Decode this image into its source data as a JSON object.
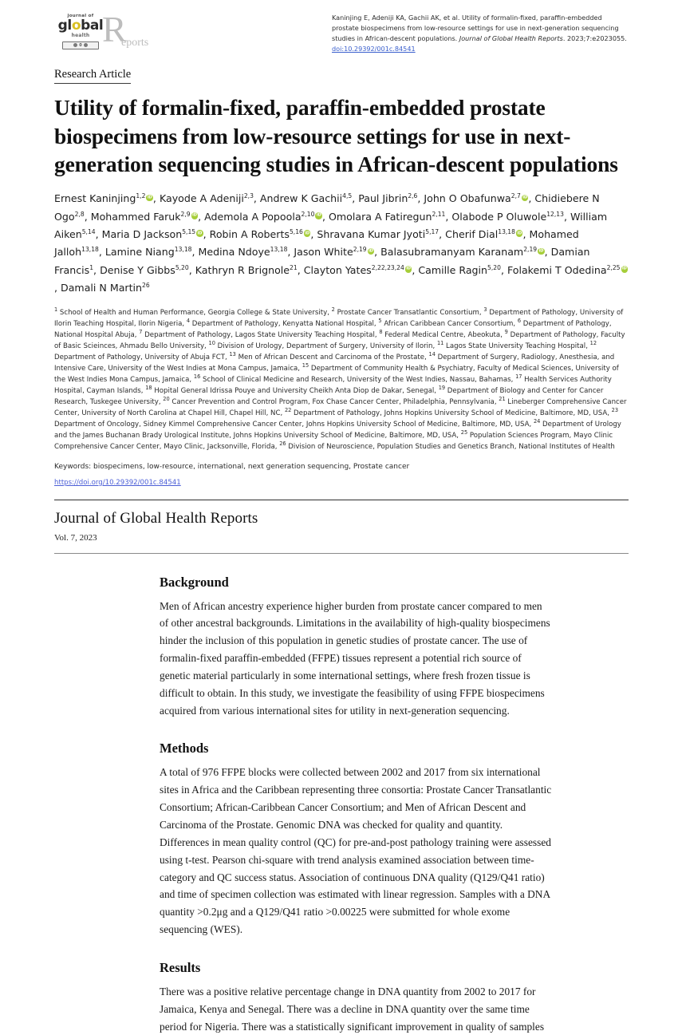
{
  "logo": {
    "journal_of": "journal of",
    "global": "global",
    "global_o": "o",
    "global_pre": "gl",
    "global_post": "bal",
    "health": "health",
    "bar_label": "0",
    "r": "R",
    "eports": "eports"
  },
  "citation": {
    "text_1": "Kaninjing E, Adeniji KA, Gachii AK, et al. Utility of formalin-fixed, paraffin-embedded prostate biospecimens from low-resource settings for use in next-generation sequencing studies in African-descent populations. ",
    "journal_italic": "Journal of Global Health Reports",
    "text_2": ". 2023;7:e2023055. ",
    "doi_label": "doi:10.29392/001c.84541"
  },
  "article": {
    "kicker": "Research Article",
    "title": "Utility of formalin-fixed, paraffin-embedded prostate biospecimens from low-resource settings for use in next-generation sequencing studies in African-descent populations",
    "keywords": "Keywords: biospecimens, low-resource, international, next generation sequencing, Prostate cancer",
    "doi_url": "https://doi.org/10.29392/001c.84541"
  },
  "authors": [
    {
      "name": "Ernest Kaninjing",
      "sup": "1,2",
      "orcid": true,
      "sep": ", "
    },
    {
      "name": "Kayode A Adeniji",
      "sup": "2,3",
      "orcid": false,
      "sep": ", "
    },
    {
      "name": "Andrew K Gachii",
      "sup": "4,5",
      "orcid": false,
      "sep": ", "
    },
    {
      "name": "Paul Jibrin",
      "sup": "2,6",
      "orcid": false,
      "sep": ", "
    },
    {
      "name": "John O Obafunwa",
      "sup": "2,7",
      "orcid": true,
      "sep": ", "
    },
    {
      "name": "Chidiebere N Ogo",
      "sup": "2,8",
      "orcid": false,
      "sep": ", "
    },
    {
      "name": "Mohammed Faruk",
      "sup": "2,9",
      "orcid": true,
      "sep": ", "
    },
    {
      "name": "Ademola A Popoola",
      "sup": "2,10",
      "orcid": true,
      "sep": ", "
    },
    {
      "name": "Omolara A Fatiregun",
      "sup": "2,11",
      "orcid": false,
      "sep": ", "
    },
    {
      "name": "Olabode P Oluwole",
      "sup": "12,13",
      "orcid": false,
      "sep": ", "
    },
    {
      "name": "William Aiken",
      "sup": "5,14",
      "orcid": false,
      "sep": ", "
    },
    {
      "name": "Maria D Jackson",
      "sup": "5,15",
      "orcid": true,
      "sep": ", "
    },
    {
      "name": "Robin A Roberts",
      "sup": "5,16",
      "orcid": true,
      "sep": ", "
    },
    {
      "name": "Shravana Kumar Jyoti",
      "sup": "5,17",
      "orcid": false,
      "sep": ", "
    },
    {
      "name": "Cherif Dial",
      "sup": "13,18",
      "orcid": true,
      "sep": ", "
    },
    {
      "name": "Mohamed Jalloh",
      "sup": "13,18",
      "orcid": false,
      "sep": ", "
    },
    {
      "name": "Lamine Niang",
      "sup": "13,18",
      "orcid": false,
      "sep": ", "
    },
    {
      "name": "Medina Ndoye",
      "sup": "13,18",
      "orcid": false,
      "sep": ", "
    },
    {
      "name": "Jason White",
      "sup": "2,19",
      "orcid": true,
      "sep": ", "
    },
    {
      "name": "Balasubramanyam Karanam",
      "sup": "2,19",
      "orcid": true,
      "sep": ", "
    },
    {
      "name": "Damian Francis",
      "sup": "1",
      "orcid": false,
      "sep": ", "
    },
    {
      "name": "Denise Y Gibbs",
      "sup": "5,20",
      "orcid": false,
      "sep": ", "
    },
    {
      "name": "Kathryn R Brignole",
      "sup": "21",
      "orcid": false,
      "sep": ", "
    },
    {
      "name": "Clayton Yates",
      "sup": "2,22,23,24",
      "orcid": true,
      "sep": ", "
    },
    {
      "name": "Camille Ragin",
      "sup": "5,20",
      "orcid": false,
      "sep": ", "
    },
    {
      "name": "Folakemi T Odedina",
      "sup": "2,25",
      "orcid": true,
      "sep": ", "
    },
    {
      "name": "Damali N Martin",
      "sup": "26",
      "orcid": false,
      "sep": ""
    }
  ],
  "affiliations": [
    {
      "num": "1",
      "text": " School of Health and Human Performance, Georgia College & State University, "
    },
    {
      "num": "2",
      "text": " Prostate Cancer Transatlantic Consortium, "
    },
    {
      "num": "3",
      "text": " Department of Pathology, University of Ilorin Teaching Hospital, Ilorin Nigeria, "
    },
    {
      "num": "4",
      "text": " Department of Pathology, Kenyatta National Hospital, "
    },
    {
      "num": "5",
      "text": " African Caribbean Cancer Consortium, "
    },
    {
      "num": "6",
      "text": " Department of Pathology, National Hospital Abuja, "
    },
    {
      "num": "7",
      "text": " Department of Pathology, Lagos State University Teaching Hospital, "
    },
    {
      "num": "8",
      "text": " Federal Medical Centre, Abeokuta, "
    },
    {
      "num": "9",
      "text": " Department of Pathology, Faculty of Basic Scieinces, Ahmadu Bello University, "
    },
    {
      "num": "10",
      "text": " Division of Urology, Department of Surgery, University of Ilorin, "
    },
    {
      "num": "11",
      "text": " Lagos State University Teaching Hospital, "
    },
    {
      "num": "12",
      "text": " Department of Pathology, University of Abuja FCT, "
    },
    {
      "num": "13",
      "text": " Men of African Descent and Carcinoma of the Prostate, "
    },
    {
      "num": "14",
      "text": " Department of Surgery, Radiology, Anesthesia, and Intensive Care, University of the West Indies at Mona Campus, Jamaica, "
    },
    {
      "num": "15",
      "text": " Department of Community Health & Psychiatry, Faculty of Medical Sciences, University of the West Indies Mona Campus, Jamaica, "
    },
    {
      "num": "16",
      "text": " School of Clinical Medicine and Research, University of the West Indies, Nassau, Bahamas, "
    },
    {
      "num": "17",
      "text": " Health Services Authority Hospital, Cayman Islands, "
    },
    {
      "num": "18",
      "text": " Hopital General Idrissa Pouye and University Cheikh Anta Diop de Dakar, Senegal, "
    },
    {
      "num": "19",
      "text": " Department of Biology and Center for Cancer Research, Tuskegee University, "
    },
    {
      "num": "20",
      "text": " Cancer Prevention and Control Program, Fox Chase Cancer Center, Philadelphia, Pennsylvania, "
    },
    {
      "num": "21",
      "text": " Lineberger Comprehensive Cancer Center, University of North Carolina at Chapel Hill, Chapel Hill, NC, "
    },
    {
      "num": "22",
      "text": " Department of Pathology, Johns Hopkins University School of Medicine, Baltimore, MD, USA, "
    },
    {
      "num": "23",
      "text": " Department of Oncology, Sidney Kimmel Comprehensive Cancer Center, Johns Hopkins University School of Medicine, Baltimore, MD, USA, "
    },
    {
      "num": "24",
      "text": " Department of Urology and the James Buchanan Brady Urological Institute, Johns Hopkins University School of Medicine, Baltimore, MD, USA, "
    },
    {
      "num": "25",
      "text": " Population Sciences Program, Mayo Clinic Comprehensive Cancer Center, Mayo Clinic, Jacksonville, Florida, "
    },
    {
      "num": "26",
      "text": " Division of Neuroscience, Population Studies and Genetics Branch, National Institutes of Health"
    }
  ],
  "journal": {
    "name": "Journal of Global Health Reports",
    "volume": "Vol. 7, 2023"
  },
  "sections": [
    {
      "heading": "Background",
      "body": "Men of African ancestry experience higher burden from prostate cancer compared to men of other ancestral backgrounds. Limitations in the availability of high-quality biospecimens hinder the inclusion of this population in genetic studies of prostate cancer. The use of formalin-fixed paraffin-embedded (FFPE) tissues represent a potential rich source of genetic material particularly in some international settings, where fresh frozen tissue is difficult to obtain. In this study, we investigate the feasibility of using FFPE biospecimens acquired from various international sites for utility in next-generation sequencing."
    },
    {
      "heading": "Methods",
      "body": "A total of 976 FFPE blocks were collected between 2002 and 2017 from six international sites in Africa and the Caribbean representing three consortia: Prostate Cancer Transatlantic Consortium; African-Caribbean Cancer Consortium; and Men of African Descent and Carcinoma of the Prostate. Genomic DNA was checked for quality and quantity. Differences in mean quality control (QC) for pre-and-post pathology training were assessed using t-test. Pearson chi-square with trend analysis examined association between time-category and QC success status. Association of continuous DNA quality (Q129/Q41 ratio) and time of specimen collection was estimated with linear regression. Samples with a DNA quantity >0.2μg and a Q129/Q41 ratio >0.00225 were submitted for whole exome sequencing (WES)."
    },
    {
      "heading": "Results",
      "body": "There was a positive relative percentage change in DNA quantity from 2002 to 2017 for Jamaica, Kenya and Senegal. There was a decline in DNA quantity over the same time period for Nigeria. There was a statistically significant improvement in quality of samples"
    }
  ],
  "colors": {
    "orcid_green": "#a6ce39",
    "link_blue": "#4c5fd7",
    "logo_yellow": "#d9c021",
    "logo_gray": "#bdbdbd"
  }
}
